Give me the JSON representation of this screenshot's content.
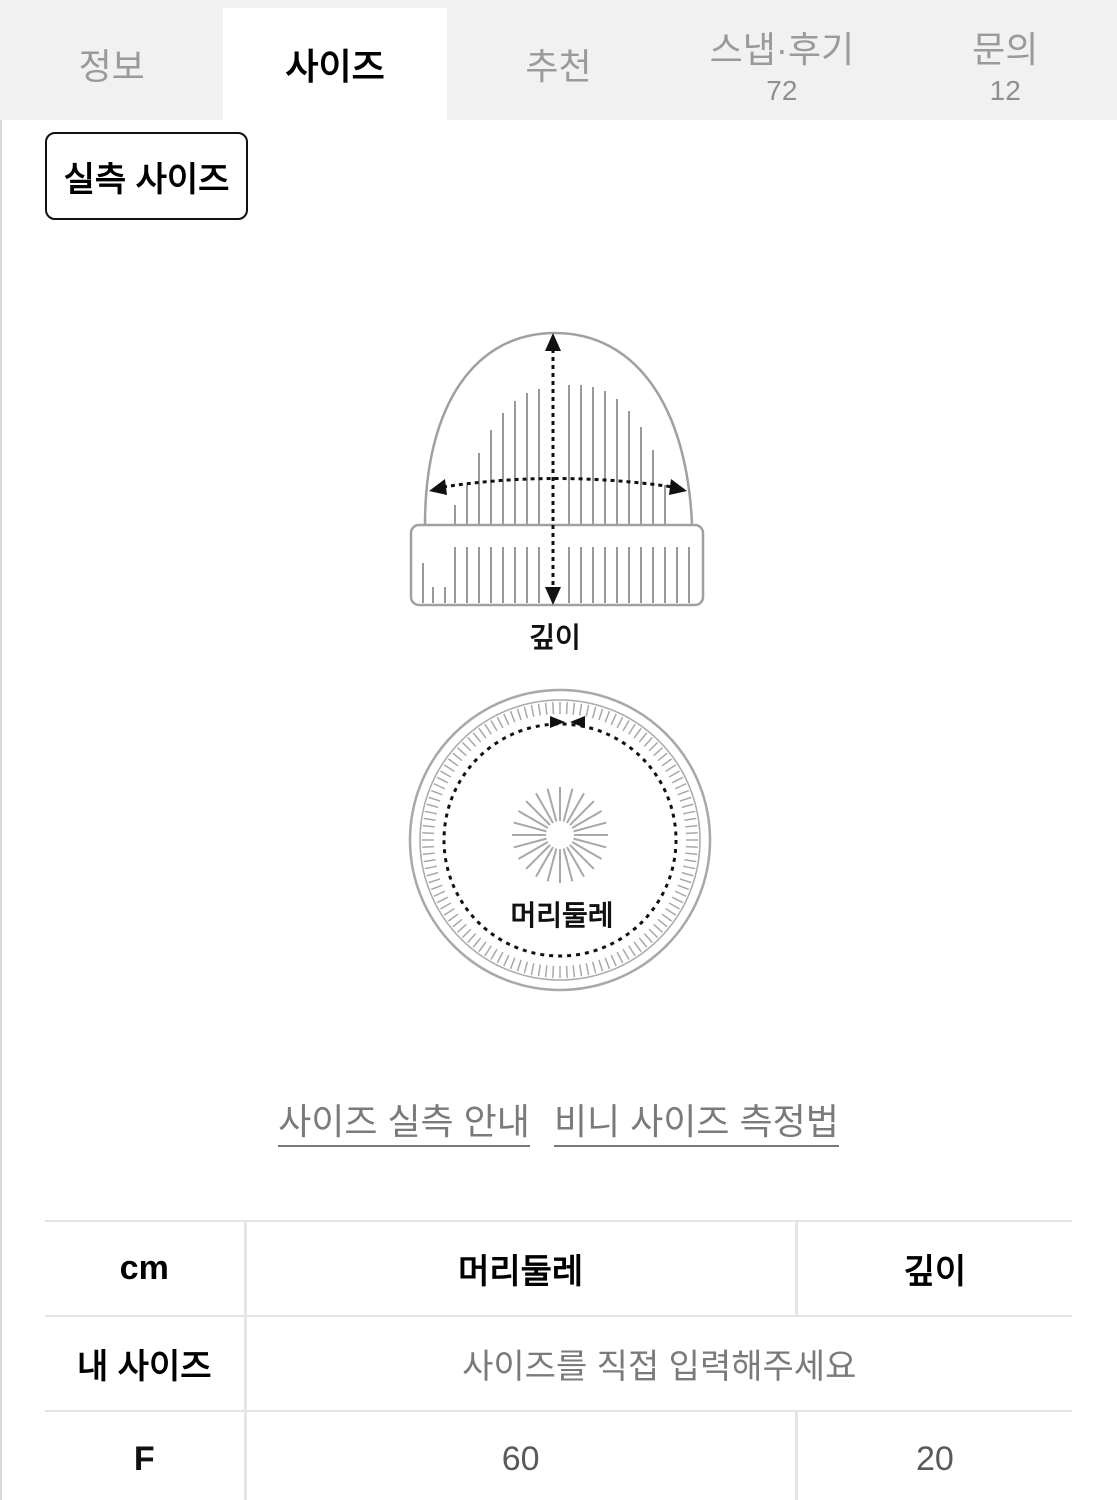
{
  "tabs": [
    {
      "label": "정보",
      "count": null,
      "active": false
    },
    {
      "label": "사이즈",
      "count": null,
      "active": true
    },
    {
      "label": "추천",
      "count": null,
      "active": false
    },
    {
      "label": "스냅·후기",
      "count": "72",
      "active": false
    },
    {
      "label": "문의",
      "count": "12",
      "active": false
    }
  ],
  "size_type_chip": "실측 사이즈",
  "diagram": {
    "beanie_label": "깊이",
    "circle_label": "머리둘레"
  },
  "links": {
    "size_guide": "사이즈 실측 안내",
    "beanie_measure": "비니 사이즈 측정법"
  },
  "table": {
    "unit_header": "cm",
    "columns": [
      "머리둘레",
      "깊이"
    ],
    "my_size_label": "내 사이즈",
    "my_size_placeholder": "사이즈를 직접 입력해주세요",
    "rows": [
      {
        "size": "F",
        "values": [
          "60",
          "20"
        ]
      }
    ]
  }
}
